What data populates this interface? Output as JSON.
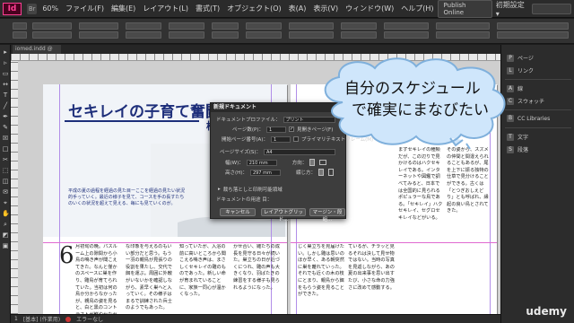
{
  "app": {
    "logo": "Id",
    "zoom": "60%",
    "menus": [
      "ファイル(F)",
      "編集(E)",
      "レイアウト(L)",
      "書式(T)",
      "オブジェクト(O)",
      "表(A)",
      "表示(V)",
      "ウィンドウ(W)",
      "ヘルプ(H)"
    ],
    "publish_label": "Publish Online",
    "workspace_label": "初期設定 ▾"
  },
  "document": {
    "tab_label": "iomed.indd @ 60%",
    "banner_title": "セキレイの子育て奮闘記",
    "banner_author": "松村",
    "banner_lead": "平成の夏の過程を経過の見た目ーここを経過の見たい状況的手っていく。最近の様子を見て、コースを手の長すたちのいくの状況を超えて見える、毎にも見ていくのが。",
    "dropcap": "6",
    "col1": "月初旬の晩。パスルーム上の隙間から小鳥の鳴き声が聞こえてきた。なんと僅かのスペースに巣を作り、雛鳥が育てられていた。当初は何の鳥か分からなかったが、親鳥の姿を見ると、白と黒のコントラストが鮮やかなセキレイであった。毎日のように虫を運ぶ親鳥の姿は、とても健気である。",
    "col2": "な印象を与えるのもいい部分だと思う。もう一羽の親鳥が見張りの役割を果たし、交代で餌を運ぶ。周囲に外敵がいないかを確認しながら、素早く巣へと入っていく。その様子はまるで訓練された兵士のようでもあった。",
    "col3": "知っていたが、入浴の前に高いところから聞こえる鳴き声は、まさしくセキレイの雛のものであった。新しい命が育まれていることに、家族一同心が温かくなった。",
    "col4": "かせ合い、雛たちの成長を見守る日々が続いた。巣立ちの日が近づくにつれ、雛の声も大きくなり、羽ばたきの練習をする様子も見られるようになった。",
    "col5": "じく巣立ちを見届けたい。しかし雛は思いのほか早く、ある朝突然に巣を離れていった。それでも近くの木の枝にとまり、親鳥から餌をもらう姿を見ることができた。",
    "col6": "ているが、チラッと見るそれは決して見せ物ではない。当時の写真を見返しながら、あの夏の出来事を思い出すたび、小さな命の力強さに改めて感動する。",
    "col7": "まずセキレイの種類だが、この辺りで見かけるのはハクセキレイである。インターネットや図鑑で調べてみると、日本では全国的に見られるポピュラーな鳥である。「セキレイ」ハクセキレイ、セグロセキレイなどがいる。",
    "col8": "その姿から、スズメの仲間と間違えられることもあるが、尾を上下に振る独特の仕草で見分けることができる。古くは「とつぎおしえどり」とも呼ばれ、縁起の良い鳥とされてきた。"
  },
  "dialog": {
    "title": "新規ドキュメント",
    "profile_label": "ドキュメントプロファイル：",
    "profile_value": "プリント",
    "pages_label": "ページ数(P)：",
    "pages_value": "1",
    "facing_label": "見開きページ(F)",
    "start_label": "開始ページ番号(A)：",
    "start_value": "1",
    "primary_label": "プライマリテキストフレーム(M)",
    "size_label": "ページサイズ(S)：",
    "size_value": "A4",
    "width_label": "幅(W)：",
    "width_value": "210 mm",
    "height_label": "高さ(H)：",
    "height_value": "297 mm",
    "orientation_label": "方向：",
    "binding_label": "綴じ方：",
    "bleed_label": "裁ち落としと印刷可能領域",
    "intent_label": "ドキュメントの用途 目：",
    "cancel_label": "キャンセル",
    "layout_grid_label": "レイアウトグリッド...",
    "margin_label": "マージン・段組..."
  },
  "panels": {
    "items": [
      {
        "icon": "P",
        "label": "ページ"
      },
      {
        "icon": "L",
        "label": "リンク"
      },
      {
        "icon": "A",
        "label": "線"
      },
      {
        "icon": "C",
        "label": "スウォッチ"
      },
      {
        "icon": "B",
        "label": "CC Libraries"
      },
      {
        "icon": "T",
        "label": "文字"
      },
      {
        "icon": "S",
        "label": "段落"
      }
    ]
  },
  "overlay": {
    "line1": "自分のスケジュール",
    "line2": "で確実にまなびたい",
    "bubble_color": "#cfe6fb"
  },
  "status": {
    "page": "1",
    "style": "[基本] (作業用)",
    "errors": "エラーなし"
  },
  "watermark": "udemy"
}
